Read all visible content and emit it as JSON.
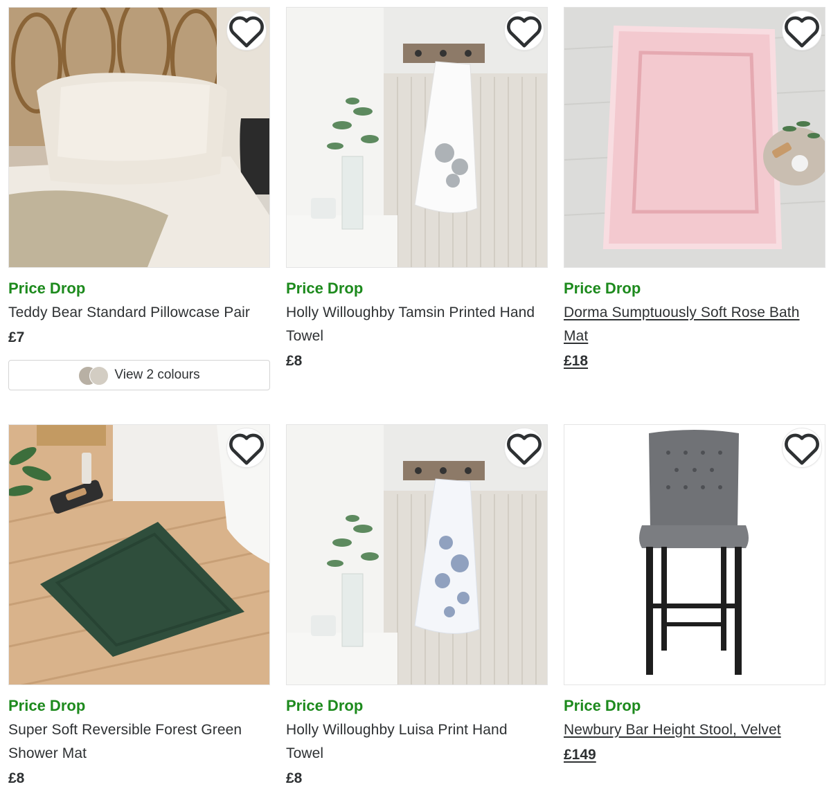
{
  "products": [
    {
      "badge": "Price Drop",
      "title": "Teddy Bear Standard Pillowcase Pair",
      "price": "£7",
      "colours_label": "View 2 colours"
    },
    {
      "badge": "Price Drop",
      "title": "Holly Willoughby Tamsin Printed Hand Towel",
      "price": "£8"
    },
    {
      "badge": "Price Drop",
      "title": "Dorma Sumptuously Soft Rose Bath Mat",
      "price": "£18"
    },
    {
      "badge": "Price Drop",
      "title": "Super Soft Reversible Forest Green Shower Mat",
      "price": "£8"
    },
    {
      "badge": "Price Drop",
      "title": "Holly Willoughby Luisa Print Hand Towel",
      "price": "£8"
    },
    {
      "badge": "Price Drop",
      "title": "Newbury Bar Height Stool, Velvet",
      "price": "£149"
    }
  ],
  "icons": {
    "wishlist": "heart-outline-icon",
    "swatch": "colour-swatch-icon"
  },
  "colors": {
    "badge": "#1d8a1d",
    "text": "#2e3133",
    "border": "#d4d4d4"
  }
}
